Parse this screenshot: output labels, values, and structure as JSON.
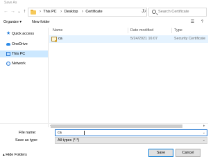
{
  "window": {
    "title": "Save As"
  },
  "nav_buttons": {
    "back": "←",
    "forward": "→",
    "dropdown": "⌄",
    "up": "↑",
    "refresh": "↻"
  },
  "address": {
    "crumbs": [
      "This PC",
      "Desktop",
      "Certificate"
    ],
    "separator": "›",
    "dropdown": "⌄"
  },
  "search": {
    "placeholder": "Search Certificate"
  },
  "toolbar": {
    "organize": "Organize ▾",
    "new_folder": "New folder",
    "view_icon": "☰",
    "help_icon": "?"
  },
  "sidebar": {
    "items": [
      {
        "label": "Quick access",
        "icon": "star-icon"
      },
      {
        "label": "OneDrive",
        "icon": "cloud-icon"
      },
      {
        "label": "This PC",
        "icon": "computer-icon",
        "selected": true
      },
      {
        "label": "Network",
        "icon": "network-icon"
      }
    ]
  },
  "columns": {
    "name": "Name",
    "date": "Date modified",
    "type": "Type"
  },
  "files": [
    {
      "name": "ca",
      "date": "5/24/2021 16:07",
      "type": "Security Certificate",
      "icon": "certificate-icon"
    }
  ],
  "scroll": {
    "left": "◂",
    "right": "▸"
  },
  "file_name": {
    "label": "File name:",
    "value": "ca",
    "dropdown": "⌄"
  },
  "save_as_type": {
    "label": "Save as type:",
    "value": "All types (*.*)",
    "dropdown": "⌄"
  },
  "footer": {
    "hide_folders": "▴ Hide Folders",
    "save": "Save",
    "cancel": "Cancel"
  },
  "colors": {
    "selection": "#cce8ff",
    "row_highlight": "#e5f3ff",
    "accent": "#0078d7"
  }
}
